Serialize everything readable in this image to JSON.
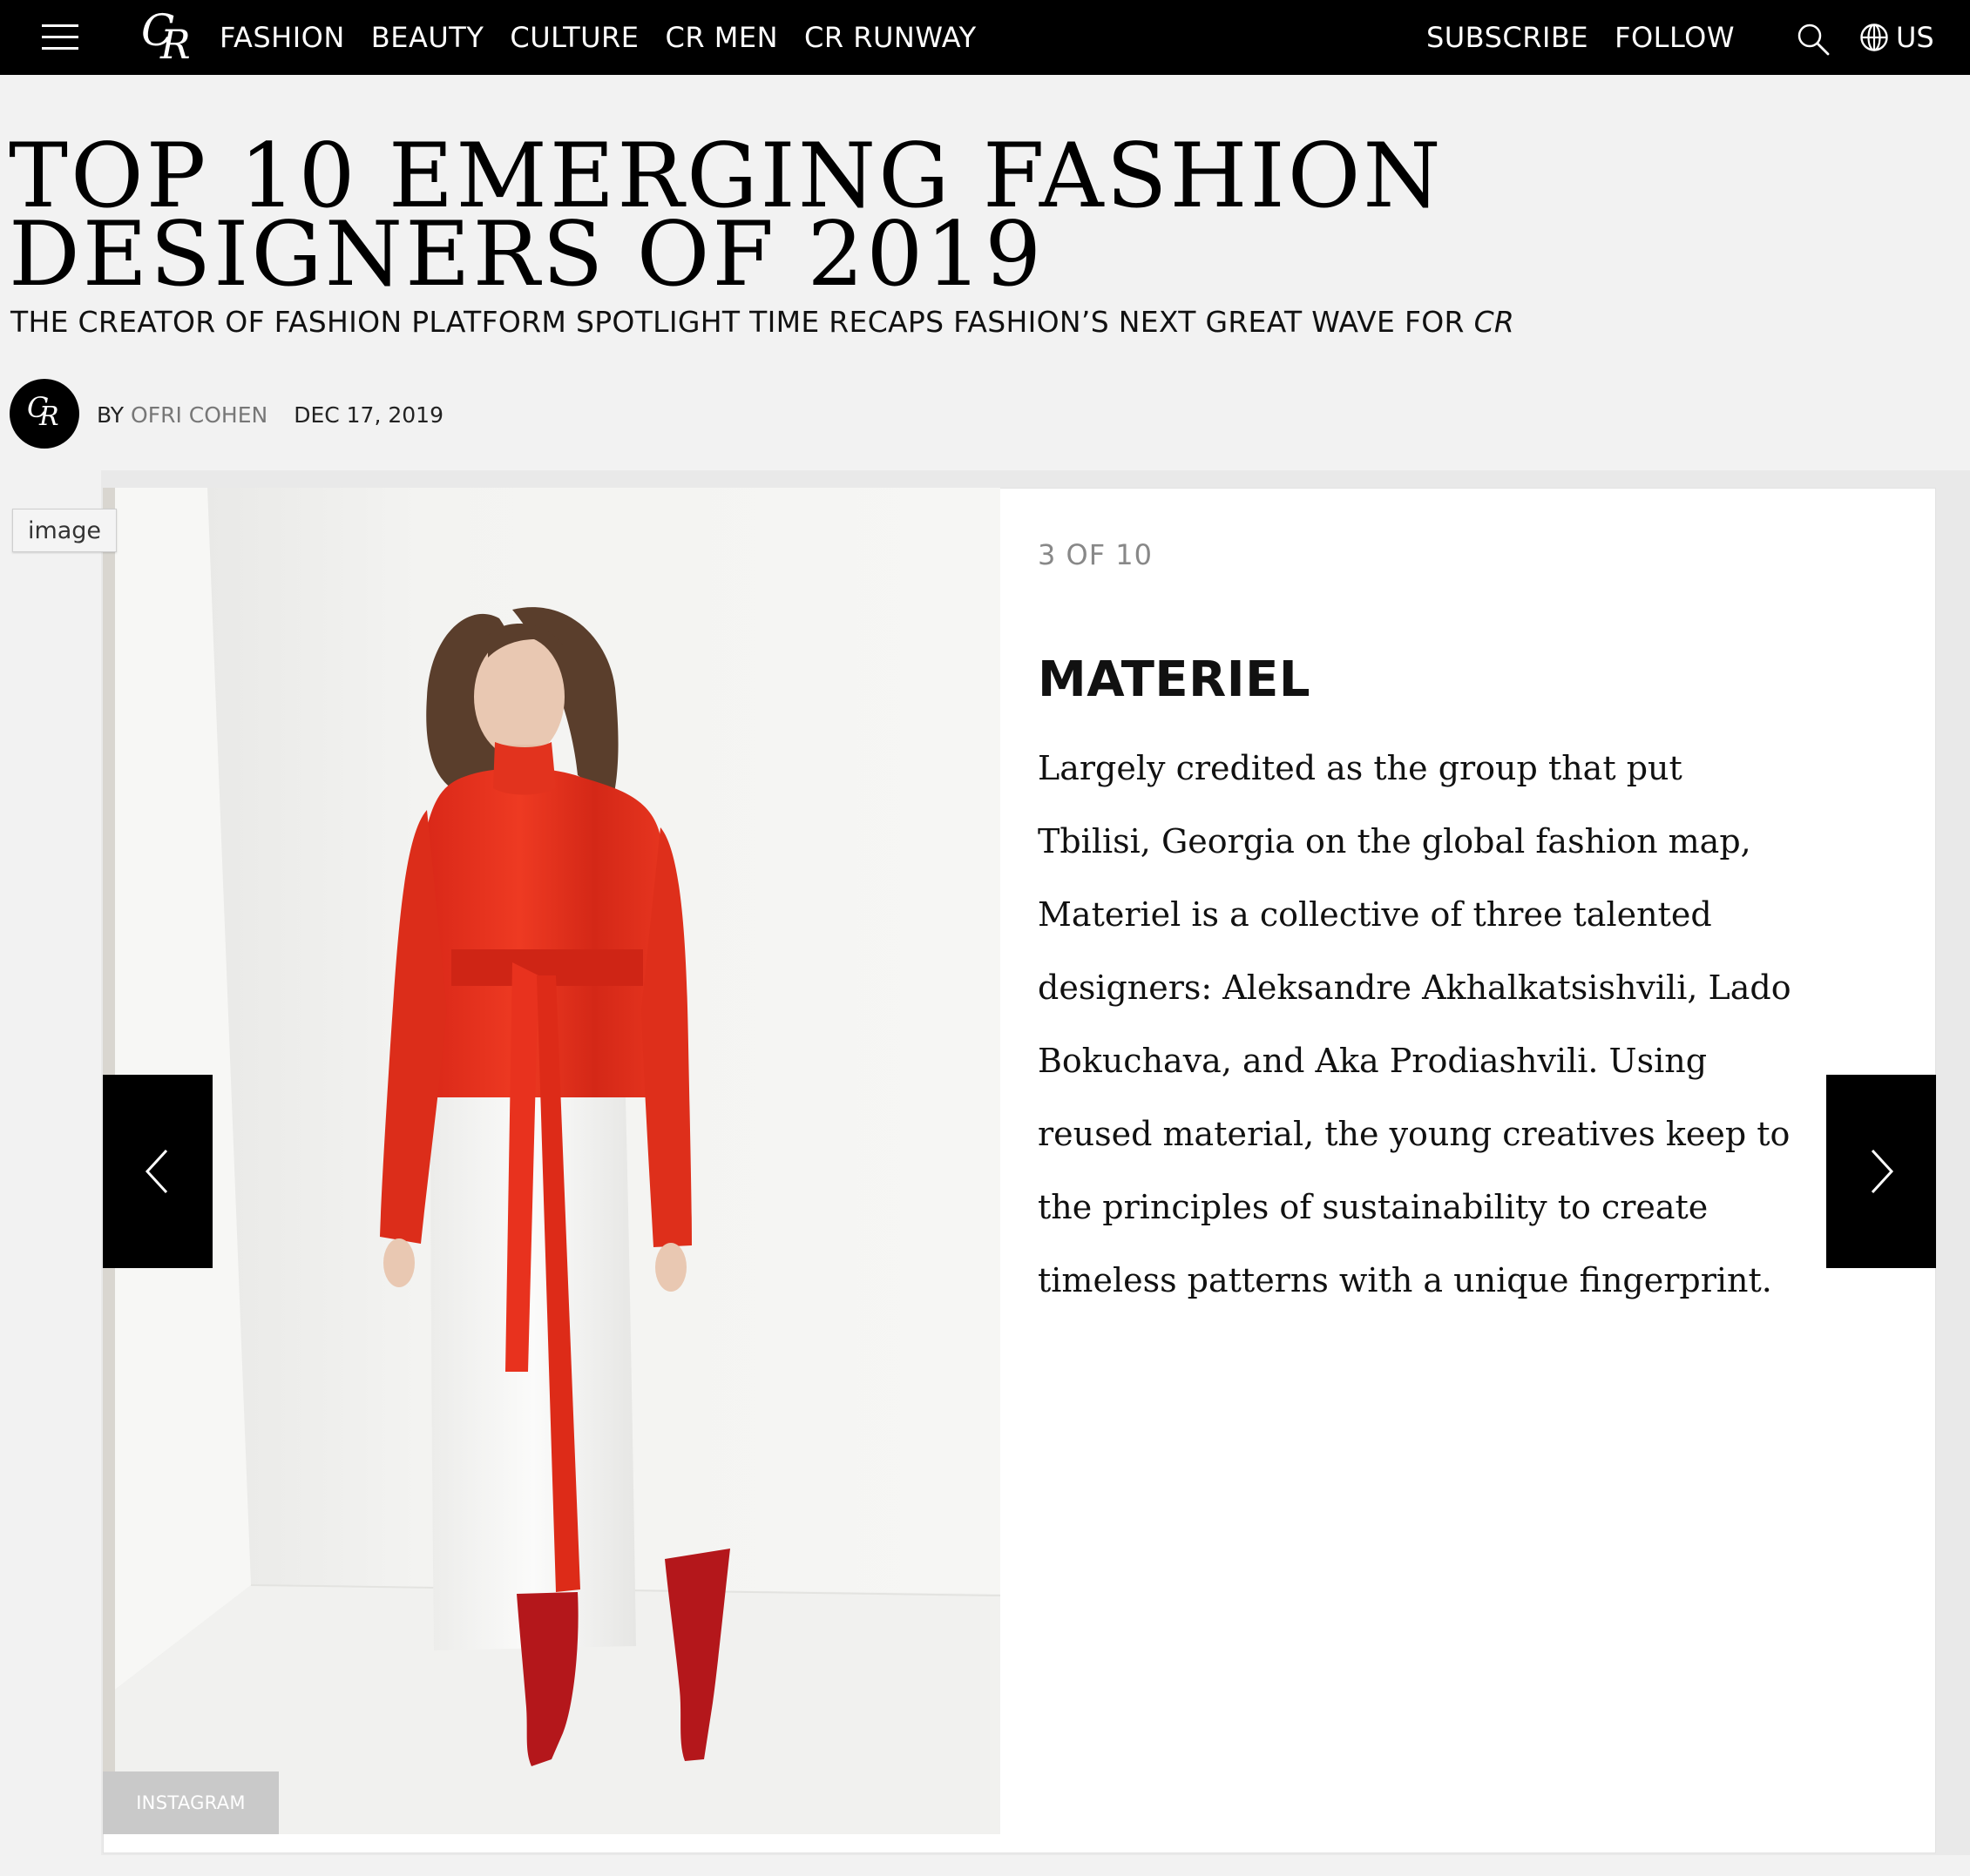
{
  "nav": {
    "logo": {
      "c": "C",
      "r": "R"
    },
    "links": [
      "FASHION",
      "BEAUTY",
      "CULTURE",
      "CR MEN",
      "CR RUNWAY"
    ],
    "subscribe": "SUBSCRIBE",
    "follow": "FOLLOW",
    "locale": "US",
    "icons": {
      "menu": "hamburger-icon",
      "search": "search-icon",
      "globe": "globe-icon"
    }
  },
  "article": {
    "headline": "TOP 10 EMERGING FASHION DESIGNERS OF 2019",
    "dek_main": "THE CREATOR OF FASHION PLATFORM SPOTLIGHT TIME RECAPS FASHION’S NEXT GREAT WAVE FOR ",
    "dek_italic": "CR",
    "byline_prefix": "BY",
    "author": "OFRI COHEN",
    "date": "DEC 17, 2019"
  },
  "slide": {
    "image_tag": "image",
    "photo_credit": "INSTAGRAM",
    "counter": "3 OF 10",
    "title": "MATERIEL",
    "body": "Largely credited as the group that put Tbilisi, Georgia on the global fashion map, Materiel is a collective of three talented designers: Aleksandre Akhalkatsishvili, Lado Bokuchava, and Aka Prodiashvili. Using reused material, the young creatives keep to the principles of sustainability to create timeless patterns with a unique fingerprint.",
    "prev_icon": "chevron-left-icon",
    "next_icon": "chevron-right-icon"
  },
  "colors": {
    "nav_bg": "#000000",
    "page_bg": "#f2f2f2",
    "blouse_red": "#e0301e",
    "boot_red": "#b8161a"
  }
}
